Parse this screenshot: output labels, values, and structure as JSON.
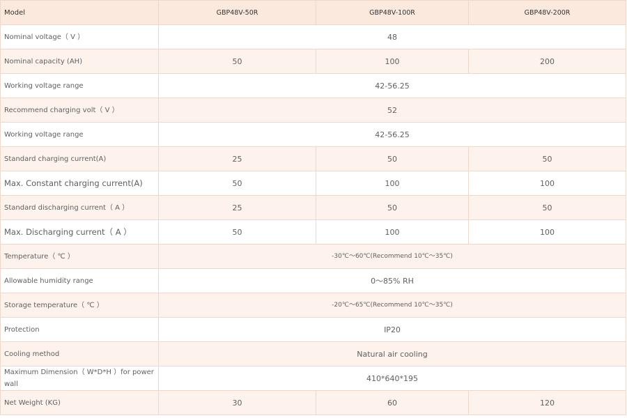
{
  "table": {
    "header": [
      "Model",
      "GBP48V-50R",
      "GBP48V-100R",
      "GBP48V-200R"
    ],
    "rows": [
      {
        "label": "Nominal voltage（ V ）",
        "values": [
          "48"
        ]
      },
      {
        "label": "Nominal capacity (AH)",
        "values": [
          "50",
          "100",
          "200"
        ]
      },
      {
        "label": "Working voltage range",
        "values": [
          "42-56.25"
        ]
      },
      {
        "label": "Recommend charging volt（ V ）",
        "values": [
          "52"
        ]
      },
      {
        "label": "Working voltage range",
        "values": [
          "42-56.25"
        ]
      },
      {
        "label": "Standard charging current(A)",
        "values": [
          "25",
          "50",
          "50"
        ]
      },
      {
        "label": "Max. Constant charging current(A)",
        "values": [
          "50",
          "100",
          "100"
        ]
      },
      {
        "label": "Standard discharging current（ A ）",
        "values": [
          "25",
          "50",
          "50"
        ]
      },
      {
        "label": "Max. Discharging current（ A ）",
        "values": [
          "50",
          "100",
          "100"
        ]
      },
      {
        "label": "Temperature（ ℃ ）",
        "values": [
          "-30℃～60℃(Recommend 10℃～35℃)"
        ]
      },
      {
        "label": "Allowable humidity range",
        "values": [
          "0～85% RH"
        ]
      },
      {
        "label": "Storage temperature（ ℃ ）",
        "values": [
          "-20℃～65℃(Recommend 10℃～35℃)"
        ]
      },
      {
        "label": "Protection",
        "values": [
          "IP20"
        ]
      },
      {
        "label": "Cooling method",
        "values": [
          "Natural air cooling"
        ]
      },
      {
        "label": "Maximum Dimension（ W*D*H ）for power wall",
        "values": [
          "410*640*195"
        ]
      },
      {
        "label": "Net Weight (KG)",
        "values": [
          "30",
          "60",
          "120"
        ]
      }
    ]
  }
}
